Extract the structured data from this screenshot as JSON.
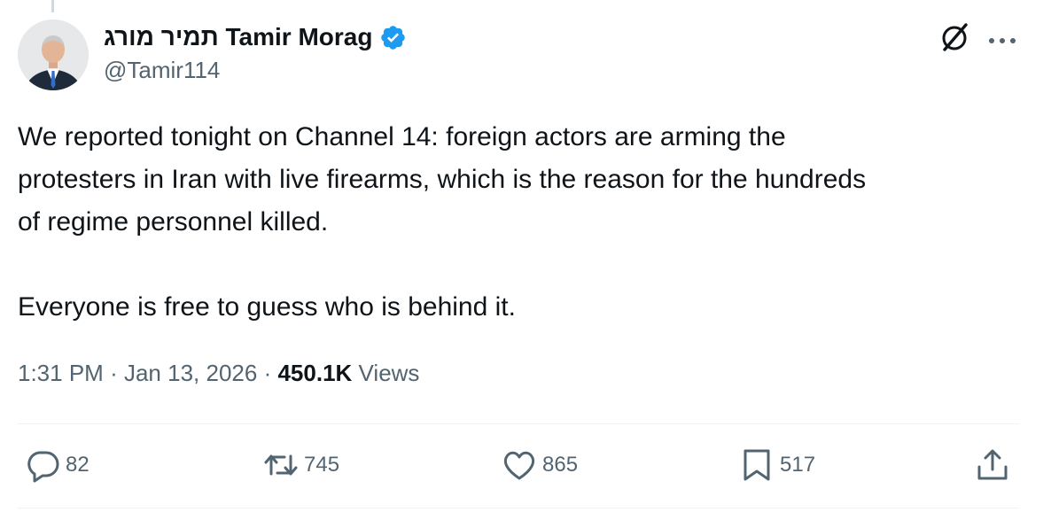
{
  "tweet": {
    "author": {
      "display_name": "תמיר מורג Tamir Morag",
      "handle": "@Tamir114",
      "verified": true
    },
    "text_lines": [
      "We reported tonight on Channel 14: foreign actors are arming the",
      "protesters in Iran with live firearms, which is the reason for the hundreds",
      "of regime personnel killed."
    ],
    "text_second_paragraph": "Everyone is free to guess who is behind it.",
    "time": "1:31 PM",
    "separator": "·",
    "date": "Jan 13, 2026",
    "views_count": "450.1K",
    "views_label": "Views"
  },
  "actions": {
    "replies": "82",
    "reposts": "745",
    "likes": "865",
    "bookmarks": "517"
  },
  "icons": {
    "verified": "verified-badge-icon",
    "grok": "grok-icon",
    "more": "more-icon",
    "reply": "reply-icon",
    "repost": "repost-icon",
    "like": "like-icon",
    "bookmark": "bookmark-icon",
    "share": "share-icon"
  },
  "colors": {
    "text_primary": "#0f1419",
    "text_secondary": "#536471",
    "verified_blue": "#1d9bf0",
    "divider": "#eff3f4"
  }
}
